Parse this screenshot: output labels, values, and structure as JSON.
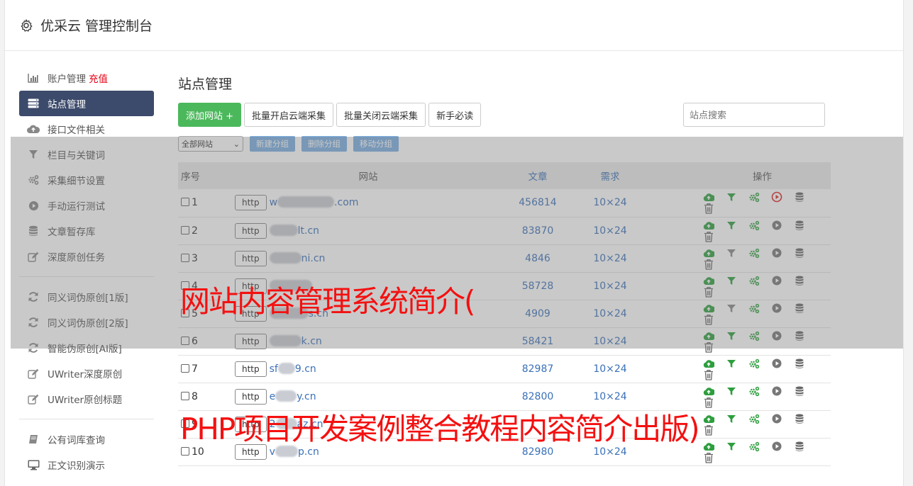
{
  "app": {
    "title": "优采云 管理控制台"
  },
  "sidebar": {
    "group1": [
      {
        "label": "账户管理",
        "extra": "充值",
        "icon": "bar-chart-icon"
      },
      {
        "label": "站点管理",
        "icon": "server-icon",
        "active": true
      },
      {
        "label": "接口文件相关",
        "icon": "cloud-upload-icon"
      },
      {
        "label": "栏目与关键词",
        "icon": "filter-icon"
      },
      {
        "label": "采集细节设置",
        "icon": "gears-icon"
      },
      {
        "label": "手动运行测试",
        "icon": "play-circle-icon"
      },
      {
        "label": "文章暂存库",
        "icon": "database-icon"
      },
      {
        "label": "深度原创任务",
        "icon": "edit-icon"
      }
    ],
    "group2": [
      {
        "label": "同义词伪原创[1版]",
        "icon": "refresh-icon"
      },
      {
        "label": "同义词伪原创[2版]",
        "icon": "refresh-icon"
      },
      {
        "label": "智能伪原创[AI版]",
        "icon": "refresh-icon"
      },
      {
        "label": "UWriter深度原创",
        "icon": "edit-icon"
      },
      {
        "label": "UWriter原创标题",
        "icon": "edit-icon"
      }
    ],
    "group3": [
      {
        "label": "公有词库查询",
        "icon": "book-icon"
      },
      {
        "label": "正文识别演示",
        "icon": "desktop-icon"
      }
    ]
  },
  "main": {
    "title": "站点管理",
    "add_button": "添加网站 +",
    "batch_open": "批量开启云端采集",
    "batch_close": "批量关闭云端采集",
    "newbie": "新手必读",
    "search_placeholder": "站点搜索",
    "group_select": "全部网站",
    "new_group": "新建分组",
    "delete_group": "删除分组",
    "move_group": "移动分组",
    "columns": [
      "序号",
      "网站",
      "文章",
      "需求",
      "操作"
    ],
    "rows": [
      {
        "no": "1",
        "prefix": "w",
        "suffix": ".com",
        "articles": "456814",
        "need": "10×24",
        "filter_active": true,
        "play_red": true
      },
      {
        "no": "2",
        "prefix": "",
        "suffix": "lt.cn",
        "articles": "83870",
        "need": "10×24",
        "filter_active": true,
        "play_red": false
      },
      {
        "no": "3",
        "prefix": "",
        "suffix": "ni.cn",
        "articles": "4846",
        "need": "10×24",
        "filter_active": false,
        "play_red": false
      },
      {
        "no": "4",
        "prefix": "",
        "suffix": "",
        "articles": "58728",
        "need": "10×24",
        "filter_active": true,
        "play_red": false
      },
      {
        "no": "5",
        "prefix": "",
        "suffix": "s.cn",
        "articles": "4909",
        "need": "10×24",
        "filter_active": false,
        "play_red": false
      },
      {
        "no": "6",
        "prefix": "",
        "suffix": "k.cn",
        "articles": "58421",
        "need": "10×24",
        "filter_active": true,
        "play_red": false
      },
      {
        "no": "7",
        "prefix": "sf",
        "suffix": "9.cn",
        "articles": "82987",
        "need": "10×24",
        "filter_active": true,
        "play_red": false
      },
      {
        "no": "8",
        "prefix": "e",
        "suffix": "y.cn",
        "articles": "82800",
        "need": "10×24",
        "filter_active": true,
        "play_red": false
      },
      {
        "no": "9",
        "prefix": "2",
        "suffix": "az.cn",
        "articles": "",
        "need": "",
        "filter_active": true,
        "play_red": false
      },
      {
        "no": "10",
        "prefix": "v",
        "suffix": "p.cn",
        "articles": "82980",
        "need": "10×24",
        "filter_active": true,
        "play_red": false
      }
    ],
    "http_label": "http"
  },
  "watermarks": {
    "line1": "网站内容管理系统简介(",
    "line2": "PHP项目开发案例整合教程内容简介出版)"
  },
  "colors": {
    "accent_green": "#4cb85c",
    "sidebar_active": "#3c4a6b",
    "link_blue": "#3a70b8",
    "watermark_red": "#f41010"
  }
}
